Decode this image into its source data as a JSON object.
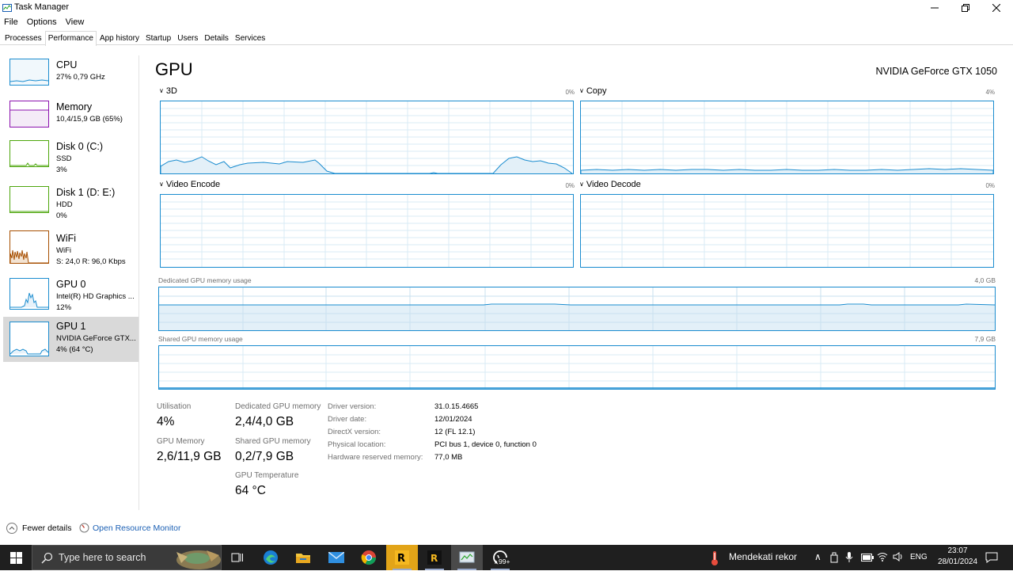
{
  "window": {
    "title": "Task Manager"
  },
  "menu": [
    "File",
    "Options",
    "View"
  ],
  "tabs": [
    "Processes",
    "Performance",
    "App history",
    "Startup",
    "Users",
    "Details",
    "Services"
  ],
  "active_tab": "Performance",
  "sidebar": [
    {
      "name": "CPU",
      "line1": "27% 0,79 GHz",
      "line2": "",
      "color": "#1a8ccf"
    },
    {
      "name": "Memory",
      "line1": "10,4/15,9 GB (65%)",
      "line2": "",
      "color": "#8b12ae"
    },
    {
      "name": "Disk 0 (C:)",
      "line1": "SSD",
      "line2": "3%",
      "color": "#4da60c"
    },
    {
      "name": "Disk 1 (D: E:)",
      "line1": "HDD",
      "line2": "0%",
      "color": "#4da60c"
    },
    {
      "name": "WiFi",
      "line1": "WiFi",
      "line2": "S: 24,0  R: 96,0 Kbps",
      "color": "#a74f01"
    },
    {
      "name": "GPU 0",
      "line1": "Intel(R) HD Graphics ...",
      "line2": "12%",
      "color": "#1a8ccf"
    },
    {
      "name": "GPU 1",
      "line1": "NVIDIA GeForce GTX...",
      "line2": "4% (64 °C)",
      "color": "#1a8ccf"
    }
  ],
  "main": {
    "title": "GPU",
    "gpu_name": "NVIDIA GeForce GTX 1050",
    "engines": [
      {
        "label": "3D",
        "pct": "0%"
      },
      {
        "label": "Copy",
        "pct": "4%"
      },
      {
        "label": "Video Encode",
        "pct": "0%"
      },
      {
        "label": "Video Decode",
        "pct": "0%"
      }
    ],
    "dedicated_label": "Dedicated GPU memory usage",
    "dedicated_max": "4,0 GB",
    "shared_label": "Shared GPU memory usage",
    "shared_max": "7,9 GB",
    "stats": {
      "utilisation_label": "Utilisation",
      "utilisation": "4%",
      "dedicated_label": "Dedicated GPU memory",
      "dedicated": "2,4/4,0 GB",
      "gpu_memory_label": "GPU Memory",
      "gpu_memory": "2,6/11,9 GB",
      "shared_label": "Shared GPU memory",
      "shared": "0,2/7,9 GB",
      "temp_label": "GPU Temperature",
      "temp": "64 °C"
    },
    "details": [
      {
        "k": "Driver version:",
        "v": "31.0.15.4665"
      },
      {
        "k": "Driver date:",
        "v": "12/01/2024"
      },
      {
        "k": "DirectX version:",
        "v": "12 (FL 12.1)"
      },
      {
        "k": "Physical location:",
        "v": "PCI bus 1, device 0, function 0"
      },
      {
        "k": "Hardware reserved memory:",
        "v": "77,0 MB"
      }
    ]
  },
  "footer": {
    "fewer": "Fewer details",
    "resource_monitor": "Open Resource Monitor"
  },
  "taskbar": {
    "search_placeholder": "Type here to search",
    "weather": "Mendekati rekor",
    "lang": "ENG",
    "time": "23:07",
    "date": "28/01/2024",
    "badge": "99+"
  },
  "colors": {
    "accent": "#1a8ccf",
    "taskbar": "#1f1f1f",
    "selected": "#d9d9d9"
  }
}
